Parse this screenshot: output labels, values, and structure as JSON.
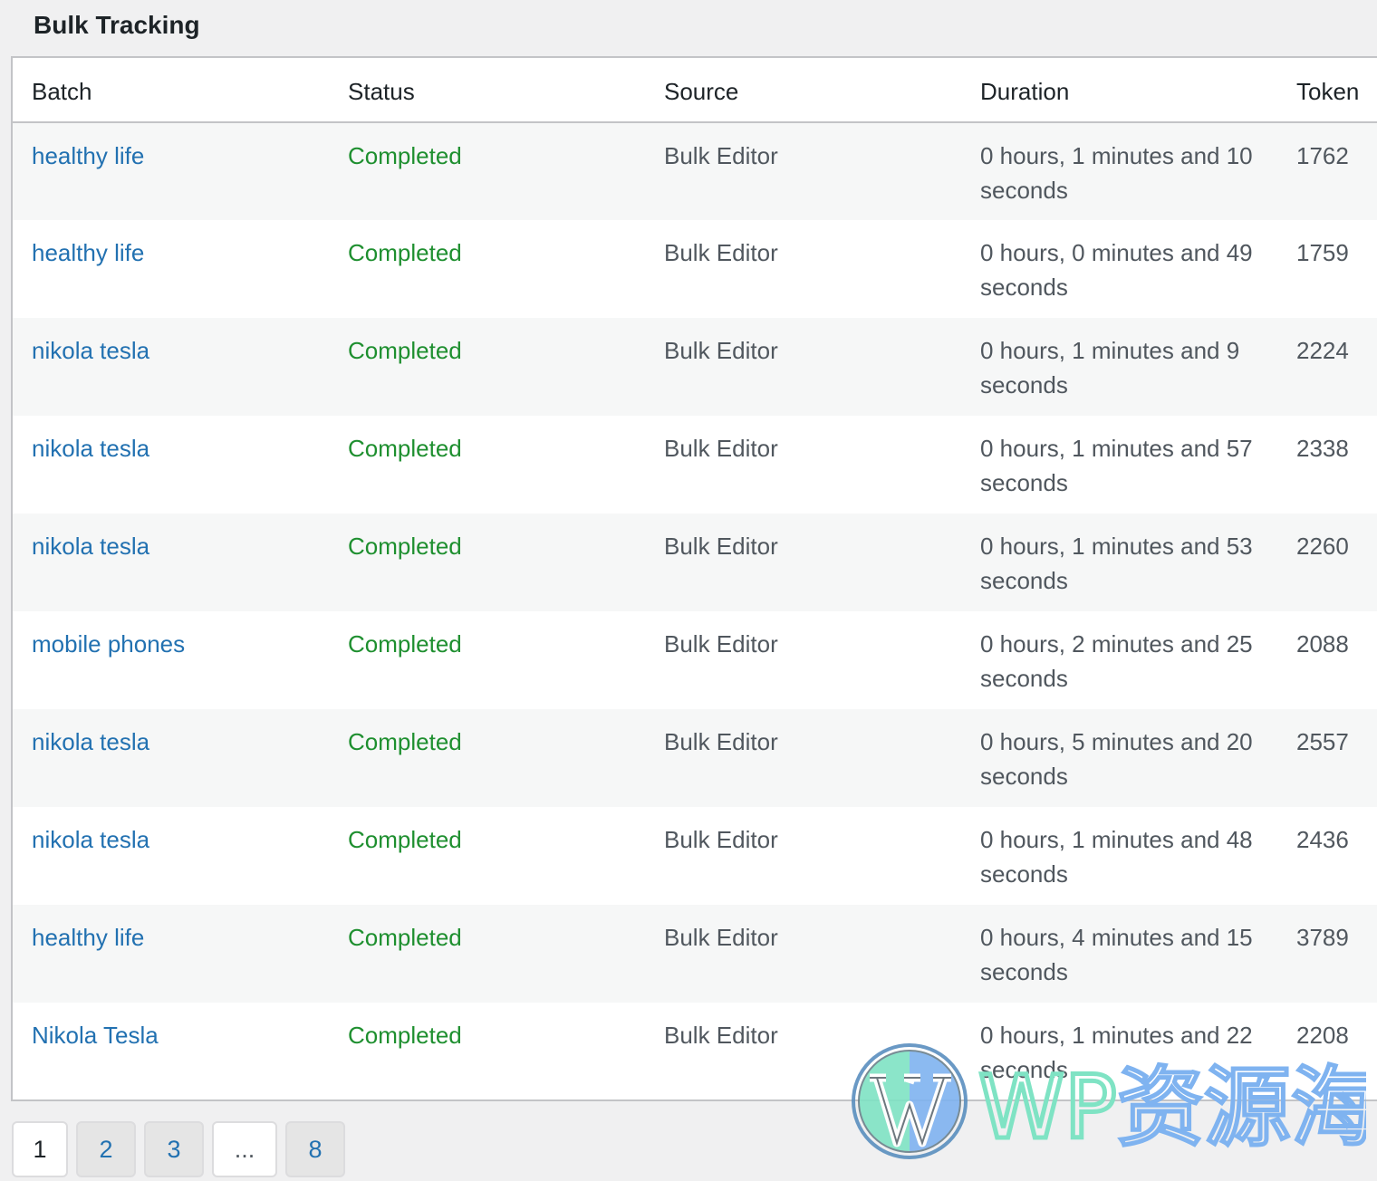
{
  "page": {
    "title": "Bulk Tracking"
  },
  "table": {
    "columns": [
      "Batch",
      "Status",
      "Source",
      "Duration",
      "Token"
    ],
    "rows": [
      {
        "batch": "healthy life",
        "status": "Completed",
        "source": "Bulk Editor",
        "duration": "0 hours, 1 minutes and 10 seconds",
        "token": "1762"
      },
      {
        "batch": "healthy life",
        "status": "Completed",
        "source": "Bulk Editor",
        "duration": "0 hours, 0 minutes and 49 seconds",
        "token": "1759"
      },
      {
        "batch": "nikola tesla",
        "status": "Completed",
        "source": "Bulk Editor",
        "duration": "0 hours, 1 minutes and 9 seconds",
        "token": "2224"
      },
      {
        "batch": "nikola tesla",
        "status": "Completed",
        "source": "Bulk Editor",
        "duration": "0 hours, 1 minutes and 57 seconds",
        "token": "2338"
      },
      {
        "batch": "nikola tesla",
        "status": "Completed",
        "source": "Bulk Editor",
        "duration": "0 hours, 1 minutes and 53 seconds",
        "token": "2260"
      },
      {
        "batch": "mobile phones",
        "status": "Completed",
        "source": "Bulk Editor",
        "duration": "0 hours, 2 minutes and 25 seconds",
        "token": "2088"
      },
      {
        "batch": "nikola tesla",
        "status": "Completed",
        "source": "Bulk Editor",
        "duration": "0 hours, 5 minutes and 20 seconds",
        "token": "2557"
      },
      {
        "batch": "nikola tesla",
        "status": "Completed",
        "source": "Bulk Editor",
        "duration": "0 hours, 1 minutes and 48 seconds",
        "token": "2436"
      },
      {
        "batch": "healthy life",
        "status": "Completed",
        "source": "Bulk Editor",
        "duration": "0 hours, 4 minutes and 15 seconds",
        "token": "3789"
      },
      {
        "batch": "Nikola Tesla",
        "status": "Completed",
        "source": "Bulk Editor",
        "duration": "0 hours, 1 minutes and 22 seconds",
        "token": "2208"
      }
    ]
  },
  "pagination": {
    "current": "1",
    "pages": [
      "1",
      "2",
      "3",
      "...",
      "8"
    ]
  },
  "watermark": {
    "text": "WP资源海",
    "icon": "wordpress-logo-icon",
    "colors": {
      "green": "#7fe3c4",
      "blue": "#7fb3f0"
    }
  },
  "colors": {
    "link": "#2271b1",
    "status_completed": "#1e8f2f"
  }
}
